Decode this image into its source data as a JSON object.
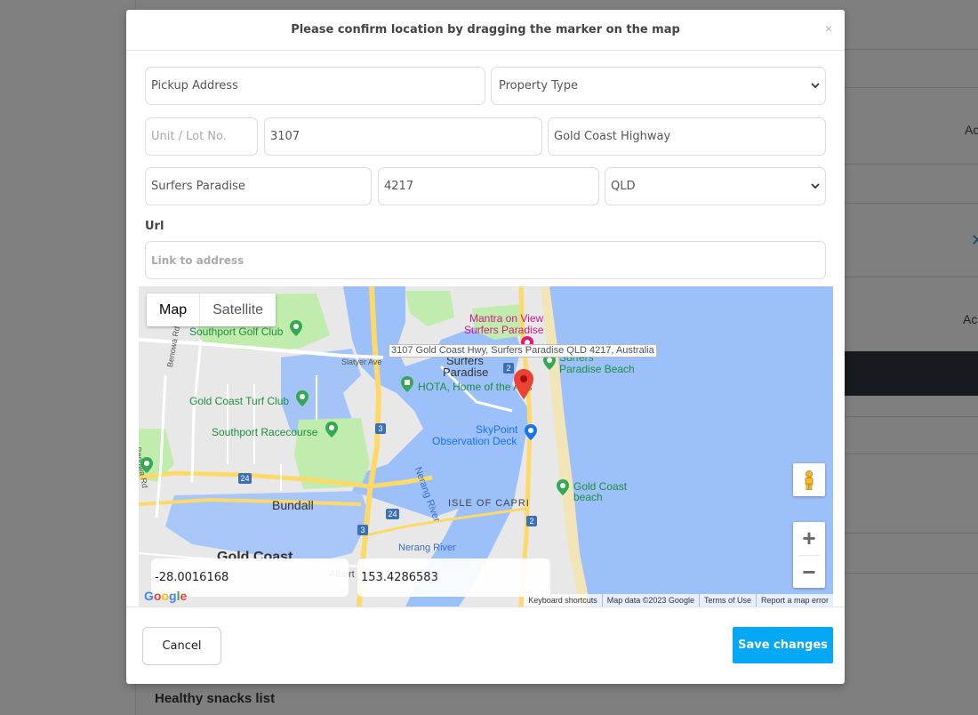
{
  "background": {
    "right_labels": [
      "Ac",
      "Ac"
    ],
    "bottom_title": "Healthy snacks list"
  },
  "modal": {
    "title": "Please confirm location by dragging the marker on the map",
    "close_glyph": "×"
  },
  "form": {
    "pickup_address_placeholder": "Pickup Address",
    "property_type": "Property Type",
    "unit_placeholder": "Unit / Lot No.",
    "street_number": "3107",
    "street_name": "Gold Coast Highway",
    "suburb": "Surfers Paradise",
    "postcode": "4217",
    "state": "QLD",
    "url_label": "Url",
    "url_placeholder": "Link to address"
  },
  "map": {
    "type_map": "Map",
    "type_satellite": "Satellite",
    "address_tooltip": "3107 Gold Coast Hwy, Surfers Paradise QLD 4217, Australia",
    "labels": {
      "southport_golf": "Southport Golf Club",
      "mantra": "Mantra on View",
      "mantra2": "Surfers Paradise",
      "surfers": "Surfers",
      "paradise": "Paradise",
      "surfers_beach1": "Surfers",
      "surfers_beach2": "Paradise Beach",
      "hota": "HOTA, Home of the Arts",
      "turf": "Gold Coast Turf Club",
      "racecourse": "Southport Racecourse",
      "skypoint1": "SkyPoint",
      "skypoint2": "Observation Deck",
      "gc_beach1": "Gold Coast",
      "gc_beach2": "beach",
      "bundall": "Bundall",
      "isle_capri": "ISLE OF CAPRI",
      "nerang_river": "Nerang River",
      "nerang_river2": "Nerang River",
      "gold_coast": "Gold Coast",
      "benowa_rd": "Benowa Rd",
      "benowa_rd2": "Benowa Rd",
      "slatyer": "Slatyer Ave",
      "albert": "Albert"
    },
    "route_badges": [
      "2",
      "2",
      "3",
      "3",
      "24",
      "24",
      "2",
      "2"
    ],
    "latitude": "-28.0016168",
    "longitude": "153.4286583",
    "footer": [
      "Keyboard shortcuts",
      "Map data ©2023 Google",
      "Terms of Use",
      "Report a map error"
    ],
    "google_logo": "Google",
    "zoom_in": "+",
    "zoom_out": "−"
  },
  "actions": {
    "cancel": "Cancel",
    "save": "Save changes"
  },
  "colors": {
    "primary": "#05a8f5",
    "water": "#9cc0f9",
    "park": "#c0ecae",
    "road": "#fdd969",
    "marker": "#ea4335",
    "poi_green": "#34a853",
    "poi_pink": "#e8127c"
  }
}
